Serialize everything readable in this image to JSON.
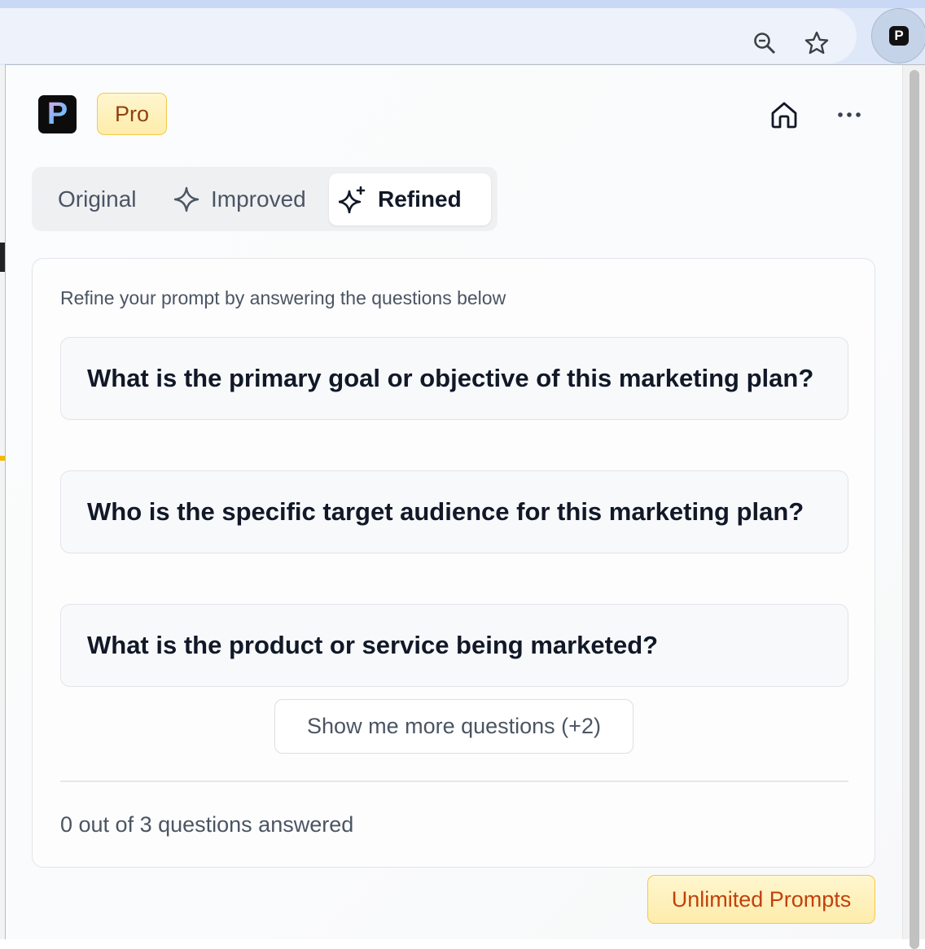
{
  "browser": {
    "icons": [
      "zoom-icon",
      "bookmark-star-icon"
    ],
    "extension_letter": "P"
  },
  "header": {
    "logo_letter": "P",
    "plan_badge": "Pro",
    "icons": [
      "home-icon",
      "more-options-icon"
    ]
  },
  "tabs": [
    {
      "label": "Original",
      "icon": null,
      "active": false
    },
    {
      "label": "Improved",
      "icon": "sparkle-icon",
      "active": false
    },
    {
      "label": "Refined",
      "icon": "sparkles-icon",
      "active": true
    }
  ],
  "panel": {
    "subtitle": "Refine your prompt by answering the questions below",
    "questions": [
      "What is the primary goal or objective of this marketing plan?",
      "Who is the specific target audience for this marketing plan?",
      "What is the product or service being marketed?"
    ],
    "more_button": "Show me more questions (+2)",
    "progress_text": "0 out of 3 questions answered"
  },
  "footer": {
    "upgrade_badge": "Unlimited Prompts"
  },
  "colors": {
    "badge_bg": "#fdecab",
    "badge_border": "#f4c94c",
    "badge_text_pro": "#92400e",
    "badge_text_unlimited": "#c2410c"
  }
}
